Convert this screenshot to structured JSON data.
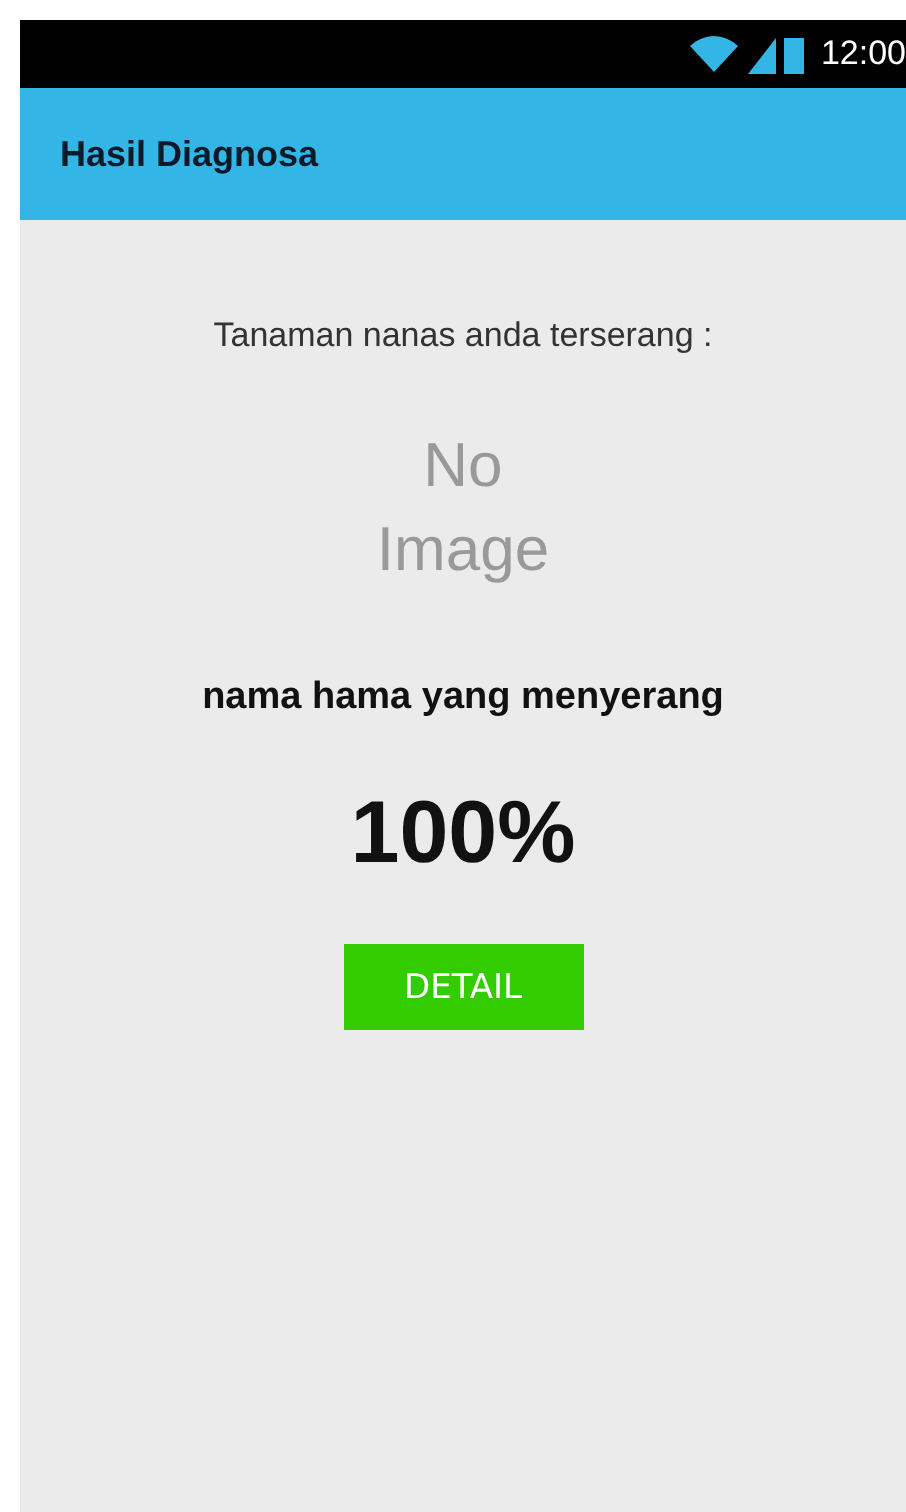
{
  "status_bar": {
    "time": "12:00"
  },
  "app_bar": {
    "title": "Hasil Diagnosa"
  },
  "content": {
    "intro": "Tanaman nanas anda terserang :",
    "image_placeholder": [
      "No",
      "Image"
    ],
    "pest_name": "nama hama yang menyerang",
    "percentage": "100%",
    "button": "DETAIL"
  }
}
